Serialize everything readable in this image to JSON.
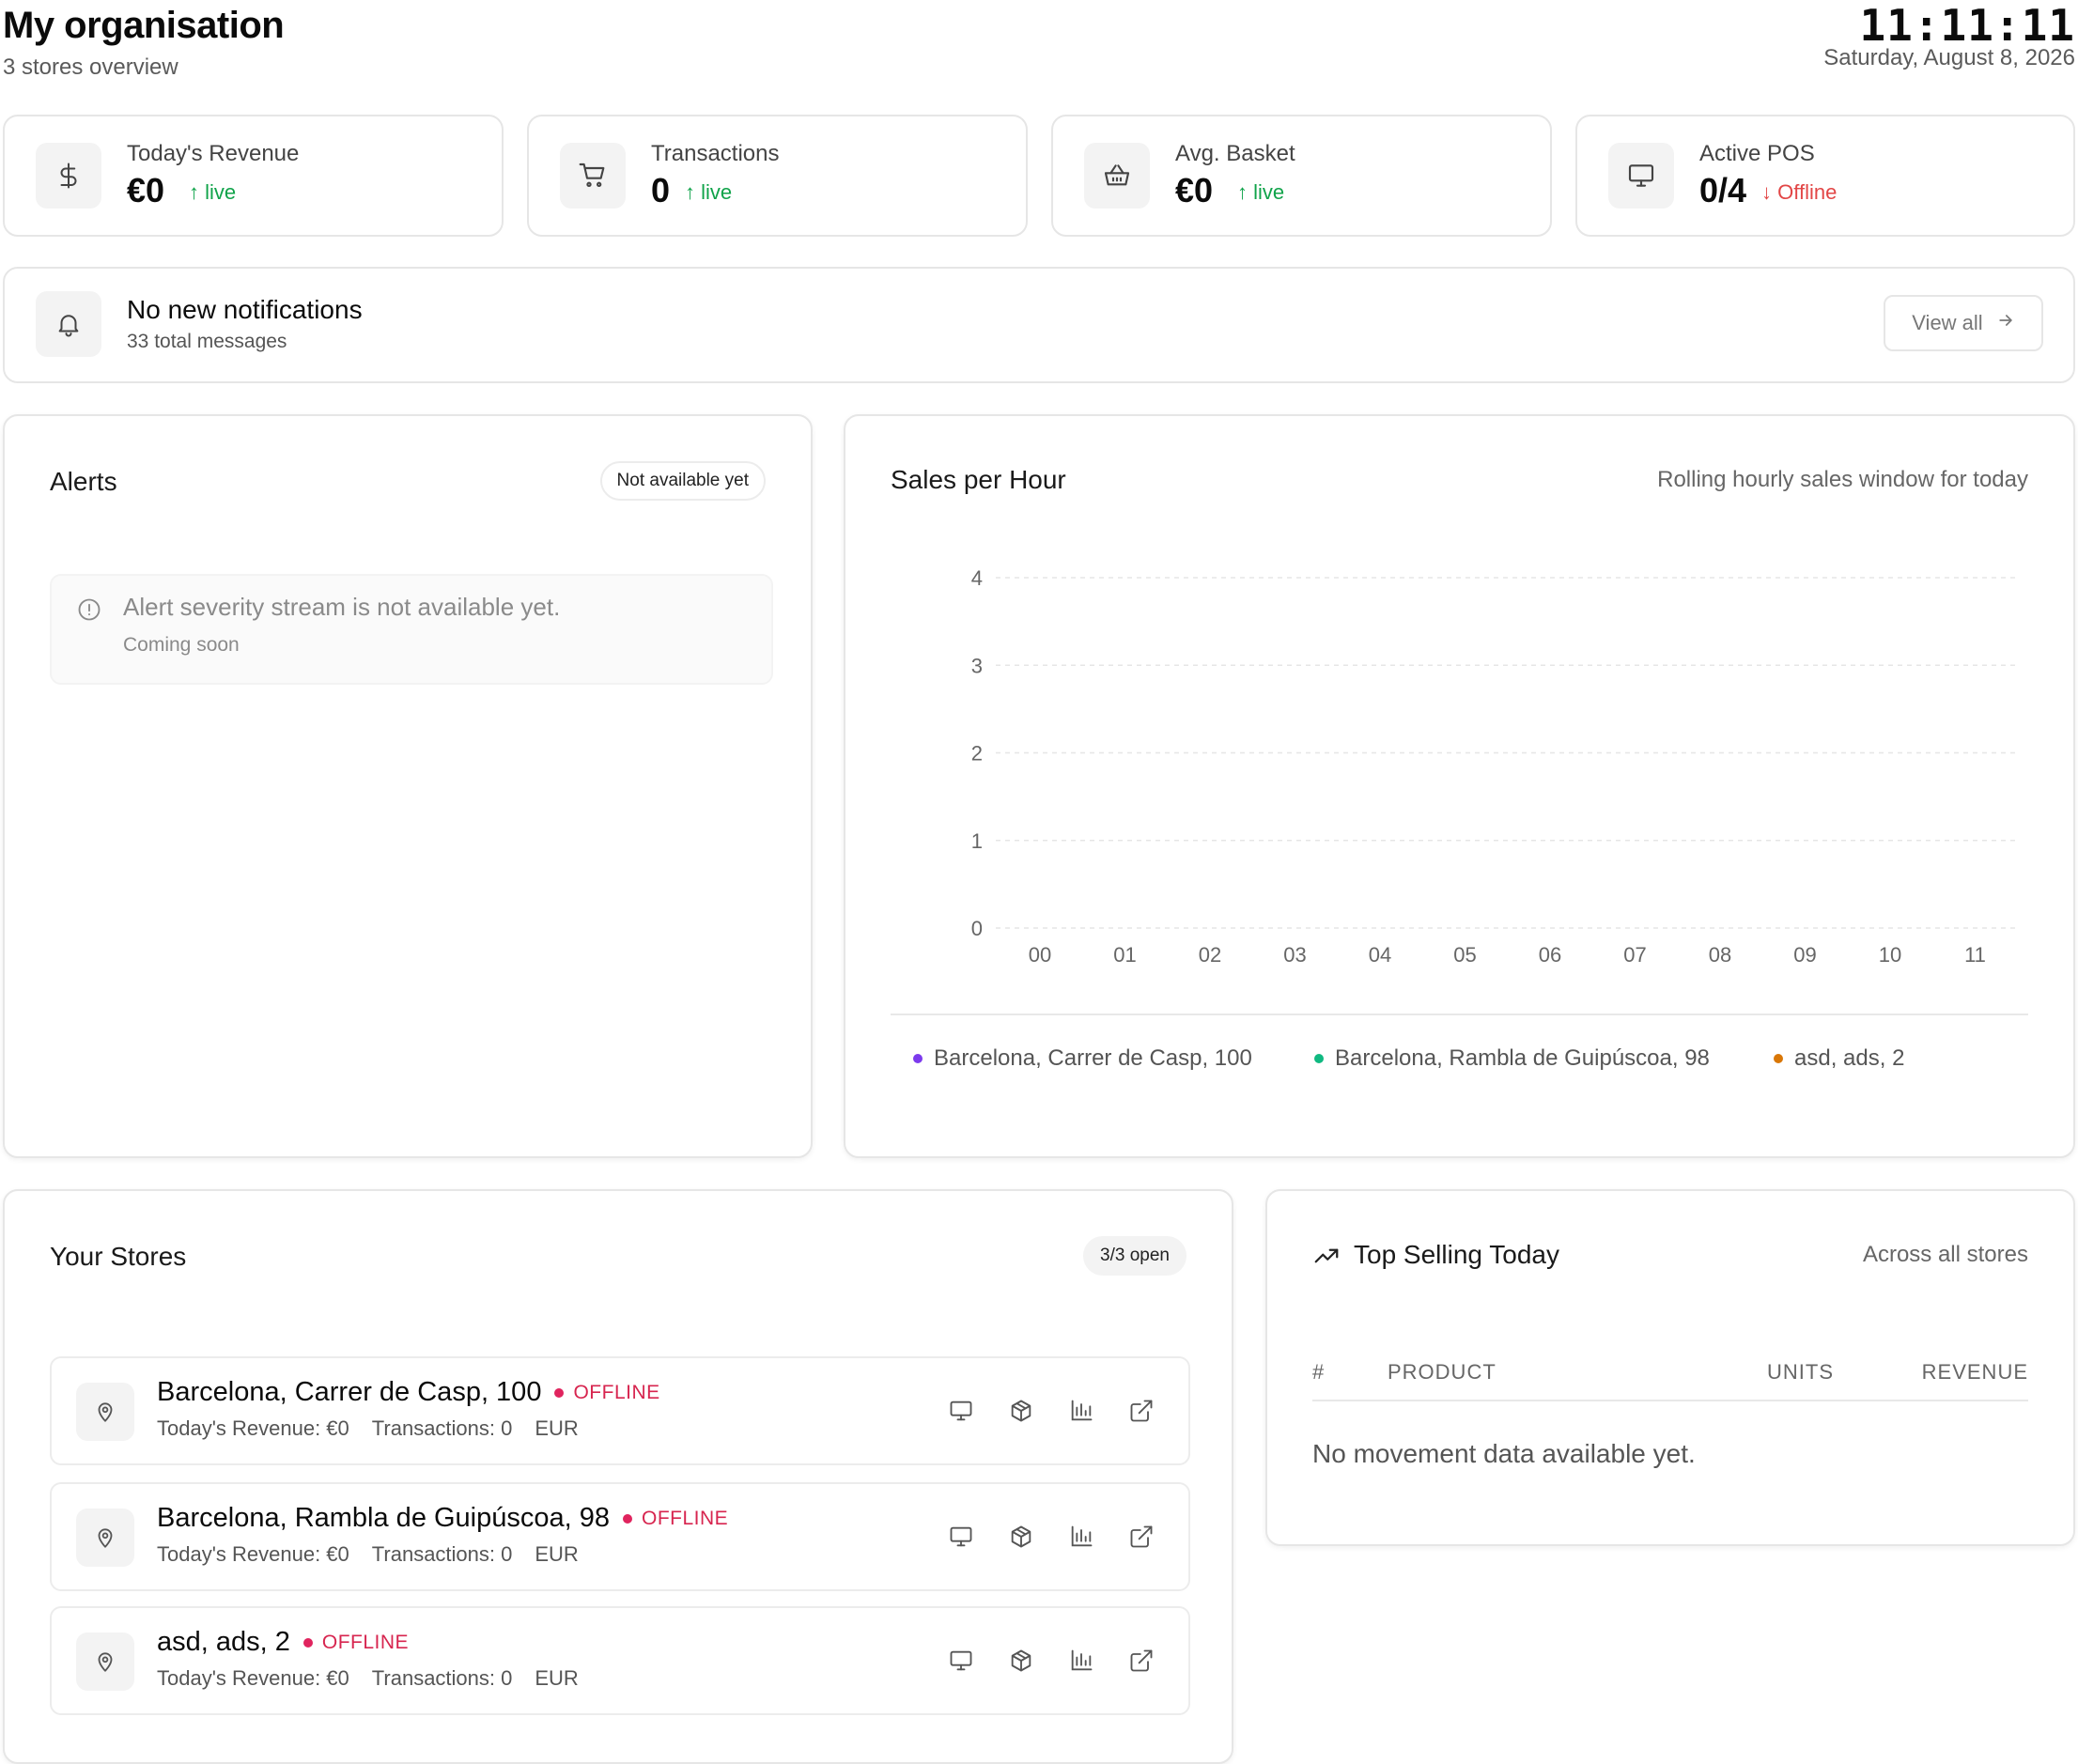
{
  "header": {
    "title": "My organisation",
    "subtitle": "3 stores overview",
    "clock": "11:11:11",
    "date": "Saturday, August 8, 2026"
  },
  "stats": [
    {
      "label": "Today's Revenue",
      "value": "€0",
      "trend": "live",
      "trend_direction": "up",
      "icon": "dollar-icon"
    },
    {
      "label": "Transactions",
      "value": "0",
      "trend": "live",
      "trend_direction": "up",
      "icon": "cart-icon"
    },
    {
      "label": "Avg. Basket",
      "value": "€0",
      "trend": "live",
      "trend_direction": "up",
      "icon": "basket-icon"
    },
    {
      "label": "Active POS",
      "value": "0/4",
      "trend": "Offline",
      "trend_direction": "down",
      "icon": "monitor-icon"
    }
  ],
  "notifications": {
    "title": "No new notifications",
    "subtitle": "33 total messages",
    "button_label": "View all"
  },
  "alerts": {
    "title": "Alerts",
    "badge": "Not available yet",
    "message": "Alert severity stream is not available yet.",
    "submessage": "Coming soon"
  },
  "sales": {
    "title": "Sales per Hour",
    "subtitle": "Rolling hourly sales window for today"
  },
  "chart_data": {
    "type": "line",
    "x": [
      "00",
      "01",
      "02",
      "03",
      "04",
      "05",
      "06",
      "07",
      "08",
      "09",
      "10",
      "11"
    ],
    "yticks": [
      "0",
      "1",
      "2",
      "3",
      "4"
    ],
    "ylim": [
      0,
      4
    ],
    "grid": true,
    "legend_position": "bottom",
    "series": [
      {
        "name": "Barcelona, Carrer de Casp, 100",
        "color": "#7c3aed",
        "values": [
          0,
          0,
          0,
          0,
          0,
          0,
          0,
          0,
          0,
          0,
          0,
          0
        ]
      },
      {
        "name": "Barcelona, Rambla de Guipúscoa, 98",
        "color": "#10b981",
        "values": [
          0,
          0,
          0,
          0,
          0,
          0,
          0,
          0,
          0,
          0,
          0,
          0
        ]
      },
      {
        "name": "asd, ads, 2",
        "color": "#d97706",
        "values": [
          0,
          0,
          0,
          0,
          0,
          0,
          0,
          0,
          0,
          0,
          0,
          0
        ]
      }
    ]
  },
  "stores": {
    "title": "Your Stores",
    "badge": "3/3 open",
    "items": [
      {
        "name": "Barcelona, Carrer de Casp, 100",
        "status": "OFFLINE",
        "revenue": "Today's Revenue: €0",
        "transactions": "Transactions: 0",
        "currency": "EUR"
      },
      {
        "name": "Barcelona, Rambla de Guipúscoa, 98",
        "status": "OFFLINE",
        "revenue": "Today's Revenue: €0",
        "transactions": "Transactions: 0",
        "currency": "EUR"
      },
      {
        "name": "asd, ads, 2",
        "status": "OFFLINE",
        "revenue": "Today's Revenue: €0",
        "transactions": "Transactions: 0",
        "currency": "EUR"
      }
    ]
  },
  "top_selling": {
    "title": "Top Selling Today",
    "subtitle": "Across all stores",
    "columns": [
      "#",
      "PRODUCT",
      "UNITS",
      "REVENUE"
    ],
    "empty": "No movement data available yet."
  },
  "colors": {
    "up": "#10a34a",
    "down": "#e24646",
    "offline": "#e0245e"
  }
}
